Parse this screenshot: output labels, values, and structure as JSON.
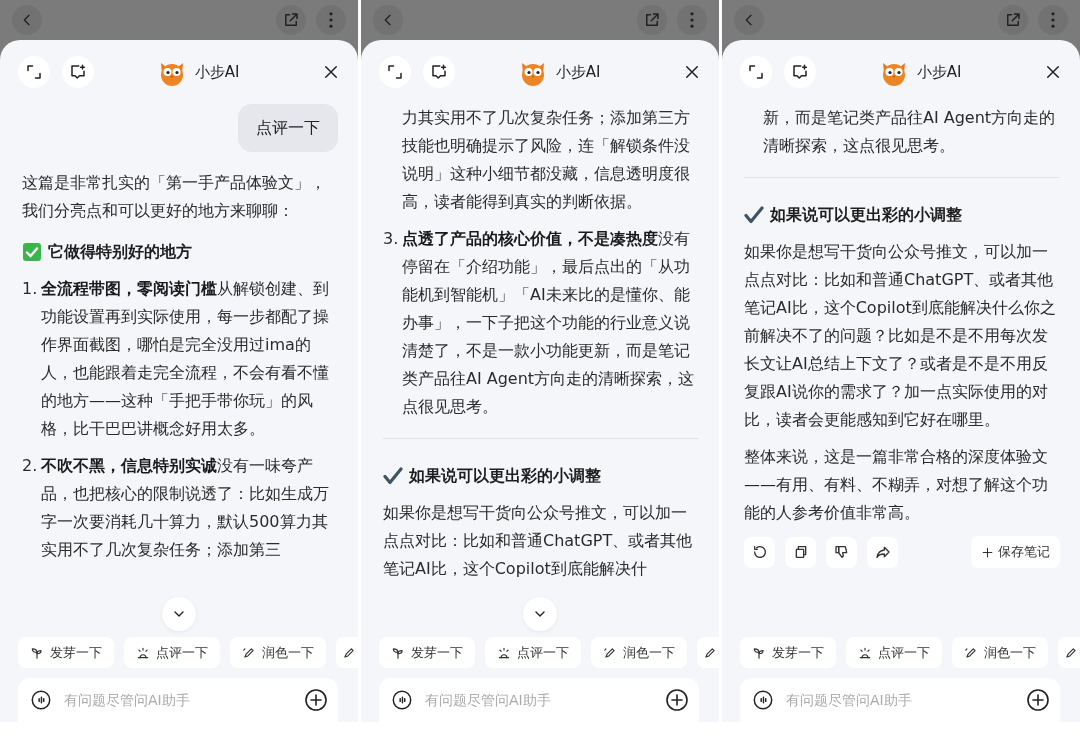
{
  "panels": [
    {
      "title": "小步AI",
      "blocks": [
        {
          "kind": "bubble",
          "text": "点评一下"
        },
        {
          "kind": "paragraph",
          "text": "这篇是非常扎实的「第一手产品体验文」，我们分亮点和可以更好的地方来聊聊："
        },
        {
          "kind": "heading",
          "text": "它做得特别好的地方"
        },
        {
          "kind": "item",
          "number": "1.",
          "text": "**全流程带图，零阅读门槛**从解锁创建、到功能设置再到实际使用，每一步都配了操作界面截图，哪怕是完全没用过ima的人，也能跟着走完全流程，不会有看不懂的地方——这种「手把手带你玩」的风格，比干巴巴讲概念好用太多。"
        },
        {
          "kind": "item",
          "number": "2.",
          "text": "**不吹不黑，信息特别实诚**没有一味夸产品，也把核心的限制说透了：比如生成万字一次要消耗几十算力，默认500算力其实用不了几次复杂任务；添加第三"
        },
        {
          "kind": "scroll_button"
        }
      ],
      "chips": [
        {
          "kind": "sprout",
          "label": "发芽一下"
        },
        {
          "kind": "review",
          "label": "点评一下"
        },
        {
          "kind": "polish",
          "label": "润色一下"
        }
      ],
      "placeholder": "有问题尽管问AI助手"
    },
    {
      "title": "小步AI",
      "blocks": [
        {
          "kind": "continuation",
          "text": "力其实用不了几次复杂任务；添加第三方技能也明确提示了风险，连「解锁条件没说明」这种小细节都没藏，信息透明度很高，读者能得到真实的判断依据。"
        },
        {
          "kind": "item",
          "number": "3.",
          "text": "**点透了产品的核心价值，不是凑热度**没有停留在「介绍功能」，最后点出的「从功能机到智能机」「AI未来比的是懂你、能办事」，一下子把这个功能的行业意义说清楚了，不是一款小功能更新，而是笔记类产品往AI Agent方向走的清晰探索，这点很见思考。"
        },
        {
          "kind": "divider"
        },
        {
          "kind": "subheading",
          "text": "如果说可以更出彩的小调整"
        },
        {
          "kind": "paragraph",
          "text": "如果你是想写干货向公众号推文，可以加一点点对比：比如和普通ChatGPT、或者其他笔记AI比，这个Copilot到底能解决什"
        },
        {
          "kind": "scroll_button"
        }
      ],
      "chips": [
        {
          "kind": "sprout",
          "label": "发芽一下"
        },
        {
          "kind": "review",
          "label": "点评一下"
        },
        {
          "kind": "polish",
          "label": "润色一下"
        }
      ],
      "placeholder": "有问题尽管问AI助手"
    },
    {
      "title": "小步AI",
      "blocks": [
        {
          "kind": "continuation",
          "text": "新，而是笔记类产品往AI Agent方向走的清晰探索，这点很见思考。"
        },
        {
          "kind": "divider"
        },
        {
          "kind": "subheading",
          "text": "如果说可以更出彩的小调整"
        },
        {
          "kind": "paragraph",
          "text": "如果你是想写干货向公众号推文，可以加一点点对比：比如和普通ChatGPT、或者其他笔记AI比，这个Copilot到底能解决什么你之前解决不了的问题？比如是不是不用每次发长文让AI总结上下文了？或者是不是不用反复跟AI说你的需求了？加一点实际使用的对比，读者会更能感知到它好在哪里。"
        },
        {
          "kind": "paragraph",
          "text": "整体来说，这是一篇非常合格的深度体验文——有用、有料、不糊弄，对想了解这个功能的人参考价值非常高。"
        },
        {
          "kind": "actions",
          "save_label": "保存笔记"
        }
      ],
      "chips": [
        {
          "kind": "sprout",
          "label": "发芽一下"
        },
        {
          "kind": "review",
          "label": "点评一下"
        },
        {
          "kind": "polish",
          "label": "润色一下"
        }
      ],
      "placeholder": "有问题尽管问AI助手"
    }
  ]
}
